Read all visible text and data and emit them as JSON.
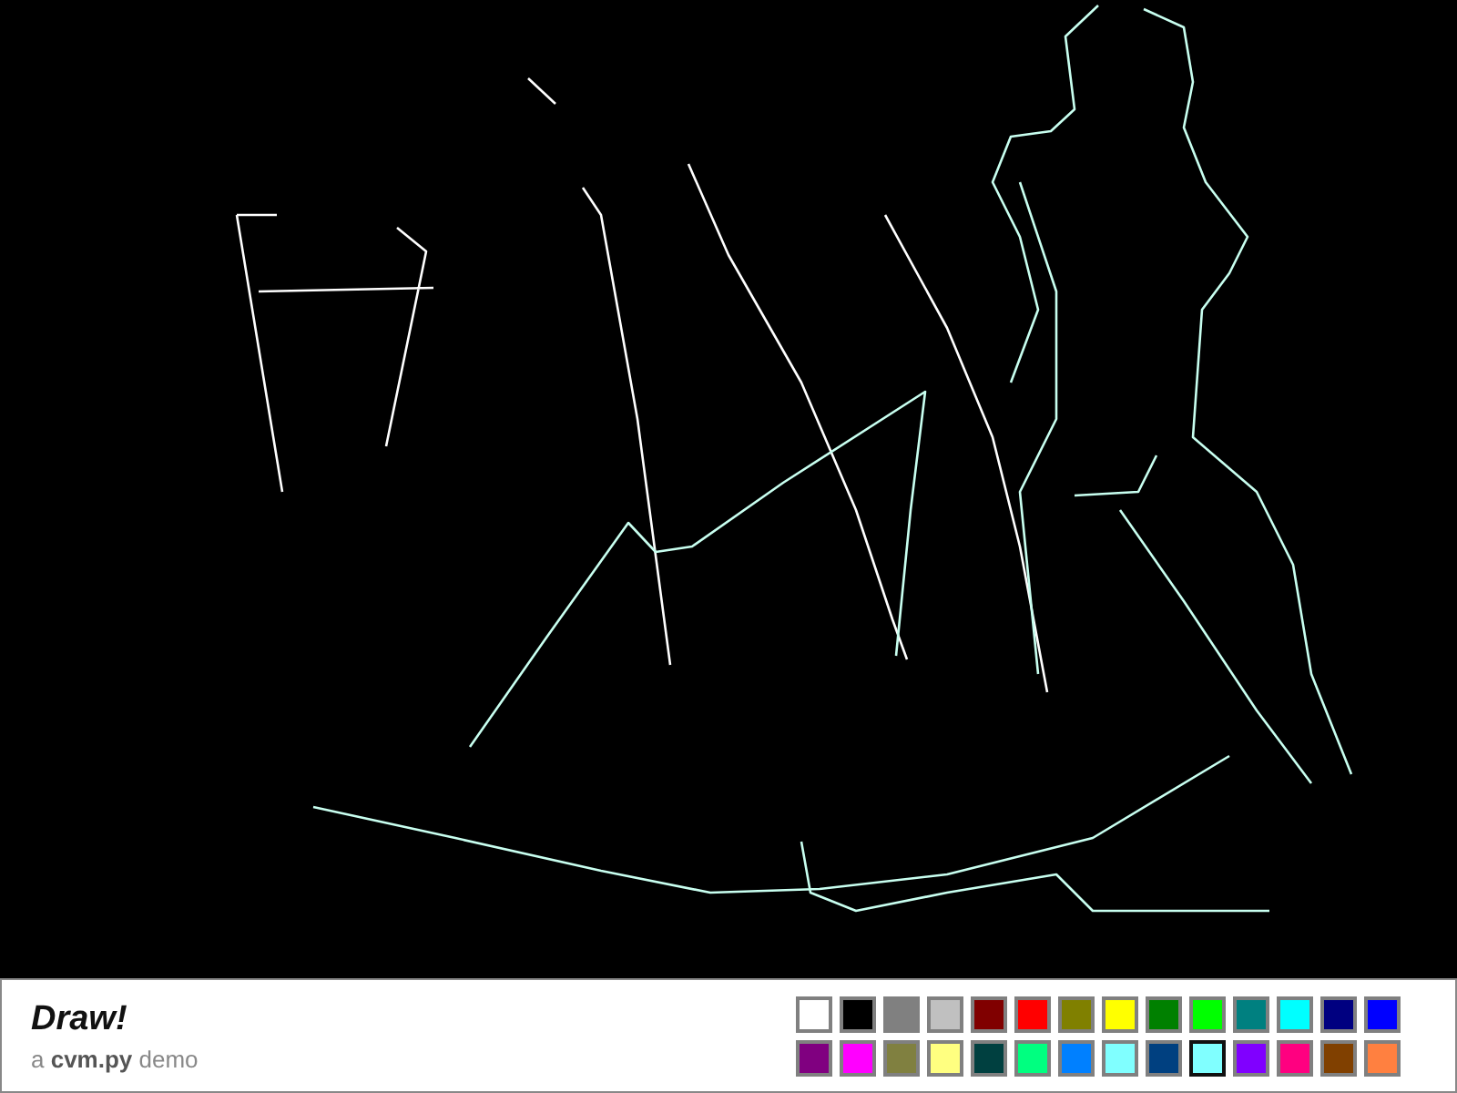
{
  "app": {
    "title": "Draw!",
    "subtitle": "a **cvm.py** demo"
  },
  "palette": [
    {
      "color": "#ffffff",
      "selected": false
    },
    {
      "color": "#000000",
      "selected": false
    },
    {
      "color": "#808080",
      "selected": false
    },
    {
      "color": "#c0c0c0",
      "selected": false
    },
    {
      "color": "#800000",
      "selected": false
    },
    {
      "color": "#ff0000",
      "selected": false
    },
    {
      "color": "#808000",
      "selected": false
    },
    {
      "color": "#ffff00",
      "selected": false
    },
    {
      "color": "#008000",
      "selected": false
    },
    {
      "color": "#00ff00",
      "selected": false
    },
    {
      "color": "#008080",
      "selected": false
    },
    {
      "color": "#00ffff",
      "selected": false
    },
    {
      "color": "#000080",
      "selected": false
    },
    {
      "color": "#0000ff",
      "selected": false
    },
    {
      "color": "#800080",
      "selected": false
    },
    {
      "color": "#ff00ff",
      "selected": false
    },
    {
      "color": "#808040",
      "selected": false
    },
    {
      "color": "#ffff80",
      "selected": false
    },
    {
      "color": "#004040",
      "selected": false
    },
    {
      "color": "#00ff80",
      "selected": false
    },
    {
      "color": "#0080ff",
      "selected": false
    },
    {
      "color": "#80ffff",
      "selected": false
    },
    {
      "color": "#004080",
      "selected": false
    },
    {
      "color": "#80ffff",
      "selected": true
    },
    {
      "color": "#8000ff",
      "selected": false
    },
    {
      "color": "#ff0080",
      "selected": false
    },
    {
      "color": "#804000",
      "selected": false
    },
    {
      "color": "#ff8040",
      "selected": false
    }
  ]
}
